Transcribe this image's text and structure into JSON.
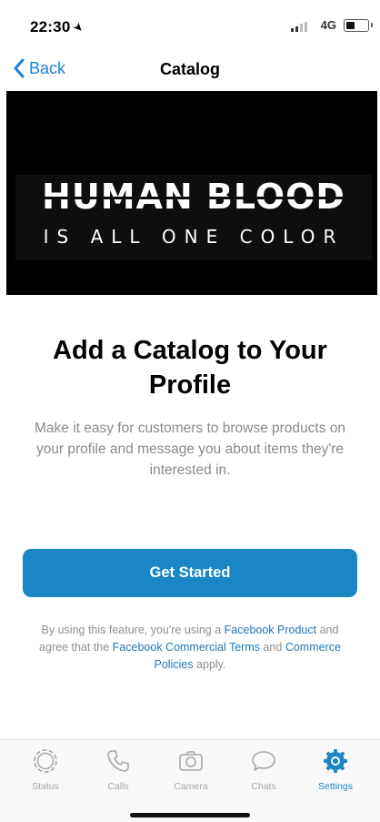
{
  "status_bar": {
    "time": "22:30",
    "network": "4G"
  },
  "nav": {
    "back_label": "Back",
    "title": "Catalog"
  },
  "banner": {
    "line1": "HUMAN BLOOD",
    "line2": "IS ALL ONE COLOR"
  },
  "content": {
    "headline": "Add a Catalog to Your Profile",
    "description": "Make it easy for customers to browse products on your profile and message you about items they're interested in.",
    "cta_label": "Get Started",
    "legal": {
      "t1": "By using this feature, you're using a ",
      "l1": "Facebook Product",
      "t2": " and agree that the ",
      "l2": "Facebook Commercial Terms",
      "t3": " and ",
      "l3": "Commerce Policies",
      "t4": " apply."
    }
  },
  "tabs": [
    {
      "label": "Status",
      "icon": "status-icon"
    },
    {
      "label": "Calls",
      "icon": "phone-icon"
    },
    {
      "label": "Camera",
      "icon": "camera-icon"
    },
    {
      "label": "Chats",
      "icon": "chat-bubble-icon"
    },
    {
      "label": "Settings",
      "icon": "gear-icon",
      "active": true
    }
  ],
  "colors": {
    "accent": "#1a86c5",
    "link": "#1f76b8",
    "nav_blue": "#1a7fe0"
  }
}
